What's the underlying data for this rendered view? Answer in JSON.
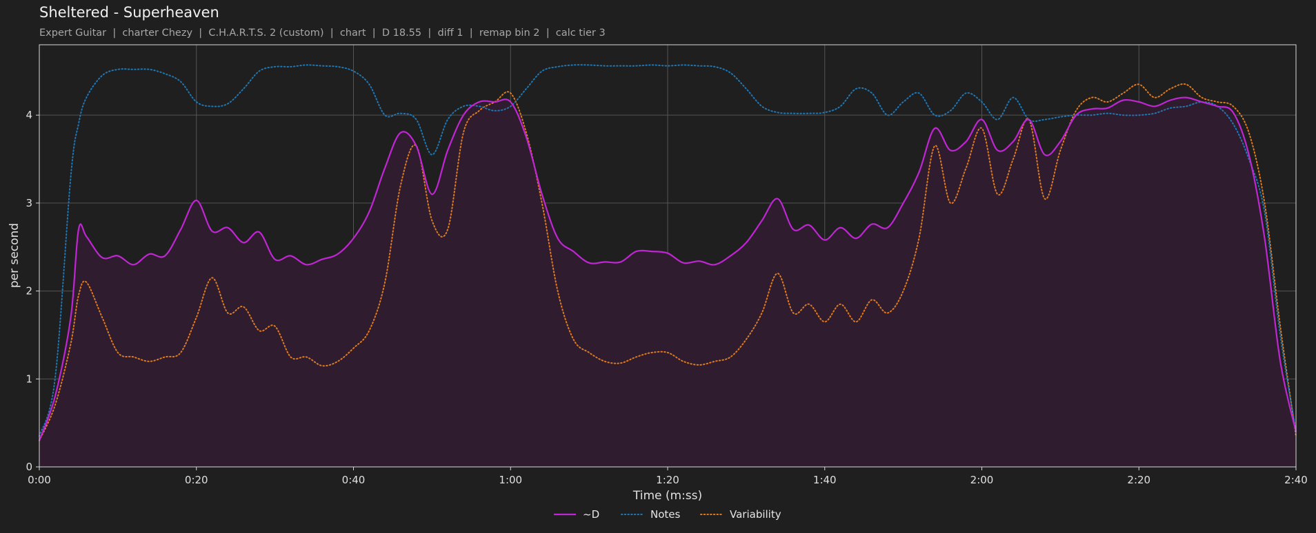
{
  "header": {
    "title": "Sheltered - Superheaven",
    "subtitle": "Expert Guitar  |  charter Chezy  |  C.H.A.R.T.S. 2 (custom)  |  chart  |  D 18.55  |  diff 1  |  remap bin 2  |  calc tier 3"
  },
  "chart_data": {
    "type": "line",
    "xlabel": "Time (m:ss)",
    "ylabel": "per second",
    "xlim": [
      0,
      160
    ],
    "ylim": [
      0,
      4.8
    ],
    "x_ticks": [
      0,
      20,
      40,
      60,
      80,
      100,
      120,
      140,
      160
    ],
    "x_tick_labels": [
      "0:00",
      "0:20",
      "0:40",
      "1:00",
      "1:20",
      "1:40",
      "2:00",
      "2:20",
      "2:40"
    ],
    "y_ticks": [
      0,
      1,
      2,
      3,
      4
    ],
    "y_tick_labels": [
      "0",
      "1",
      "2",
      "3",
      "4"
    ],
    "grid": true,
    "legend": "bottom-center",
    "colors": {
      "d": "#c026d3",
      "notes": "#1f77b4",
      "variability": "#e07a1f",
      "fill": "#2f1d2f",
      "background": "#1f1f1f",
      "grid": "#555555"
    },
    "x": [
      0,
      2,
      4,
      5,
      6,
      8,
      10,
      12,
      14,
      16,
      18,
      20,
      22,
      24,
      26,
      28,
      30,
      32,
      34,
      36,
      38,
      40,
      42,
      44,
      46,
      48,
      50,
      52,
      54,
      56,
      58,
      60,
      62,
      64,
      66,
      68,
      70,
      72,
      74,
      76,
      78,
      80,
      82,
      84,
      86,
      88,
      90,
      92,
      94,
      96,
      98,
      100,
      102,
      104,
      106,
      108,
      110,
      112,
      114,
      116,
      118,
      120,
      122,
      124,
      126,
      128,
      130,
      132,
      134,
      136,
      138,
      140,
      142,
      144,
      146,
      148,
      150,
      152,
      154,
      156,
      158,
      160
    ],
    "series": [
      {
        "name": "~D",
        "values": [
          0.3,
          0.8,
          1.7,
          2.7,
          2.62,
          2.38,
          2.4,
          2.3,
          2.42,
          2.4,
          2.7,
          3.03,
          2.68,
          2.72,
          2.55,
          2.67,
          2.36,
          2.4,
          2.3,
          2.36,
          2.42,
          2.6,
          2.9,
          3.4,
          3.8,
          3.65,
          3.1,
          3.6,
          4.0,
          4.15,
          4.15,
          4.15,
          3.75,
          3.1,
          2.6,
          2.45,
          2.32,
          2.33,
          2.33,
          2.45,
          2.45,
          2.43,
          2.32,
          2.34,
          2.3,
          2.4,
          2.55,
          2.8,
          3.05,
          2.7,
          2.75,
          2.58,
          2.72,
          2.6,
          2.76,
          2.72,
          3.0,
          3.35,
          3.85,
          3.6,
          3.7,
          3.95,
          3.6,
          3.7,
          3.95,
          3.55,
          3.7,
          4.0,
          4.07,
          4.08,
          4.17,
          4.15,
          4.1,
          4.17,
          4.2,
          4.15,
          4.1,
          4.03,
          3.55,
          2.6,
          1.2,
          0.4
        ]
      },
      {
        "name": "Notes",
        "values": [
          0.35,
          1.0,
          3.3,
          3.9,
          4.2,
          4.45,
          4.52,
          4.52,
          4.52,
          4.47,
          4.38,
          4.15,
          4.1,
          4.13,
          4.3,
          4.5,
          4.55,
          4.55,
          4.57,
          4.56,
          4.55,
          4.5,
          4.35,
          4.0,
          4.02,
          3.95,
          3.55,
          3.95,
          4.1,
          4.1,
          4.05,
          4.1,
          4.3,
          4.5,
          4.55,
          4.57,
          4.57,
          4.56,
          4.56,
          4.56,
          4.57,
          4.56,
          4.57,
          4.56,
          4.55,
          4.48,
          4.3,
          4.1,
          4.03,
          4.02,
          4.02,
          4.03,
          4.1,
          4.3,
          4.25,
          4.0,
          4.15,
          4.25,
          4.0,
          4.05,
          4.25,
          4.15,
          3.95,
          4.2,
          3.95,
          3.95,
          3.98,
          4.0,
          4.0,
          4.02,
          4.0,
          4.0,
          4.02,
          4.08,
          4.1,
          4.15,
          4.1,
          3.9,
          3.5,
          2.9,
          1.5,
          0.4
        ]
      },
      {
        "name": "Variability",
        "values": [
          0.3,
          0.7,
          1.4,
          1.95,
          2.1,
          1.7,
          1.3,
          1.25,
          1.2,
          1.25,
          1.3,
          1.7,
          2.15,
          1.75,
          1.82,
          1.55,
          1.6,
          1.25,
          1.25,
          1.15,
          1.2,
          1.35,
          1.55,
          2.1,
          3.2,
          3.65,
          2.8,
          2.7,
          3.8,
          4.05,
          4.15,
          4.25,
          3.8,
          3.0,
          2.0,
          1.45,
          1.3,
          1.2,
          1.18,
          1.25,
          1.3,
          1.3,
          1.2,
          1.16,
          1.2,
          1.25,
          1.45,
          1.75,
          2.2,
          1.75,
          1.85,
          1.65,
          1.85,
          1.65,
          1.9,
          1.75,
          2.0,
          2.6,
          3.65,
          3.0,
          3.4,
          3.85,
          3.1,
          3.5,
          3.95,
          3.05,
          3.6,
          4.05,
          4.2,
          4.15,
          4.25,
          4.35,
          4.2,
          4.3,
          4.35,
          4.2,
          4.15,
          4.1,
          3.8,
          3.0,
          1.6,
          0.35
        ]
      }
    ]
  }
}
